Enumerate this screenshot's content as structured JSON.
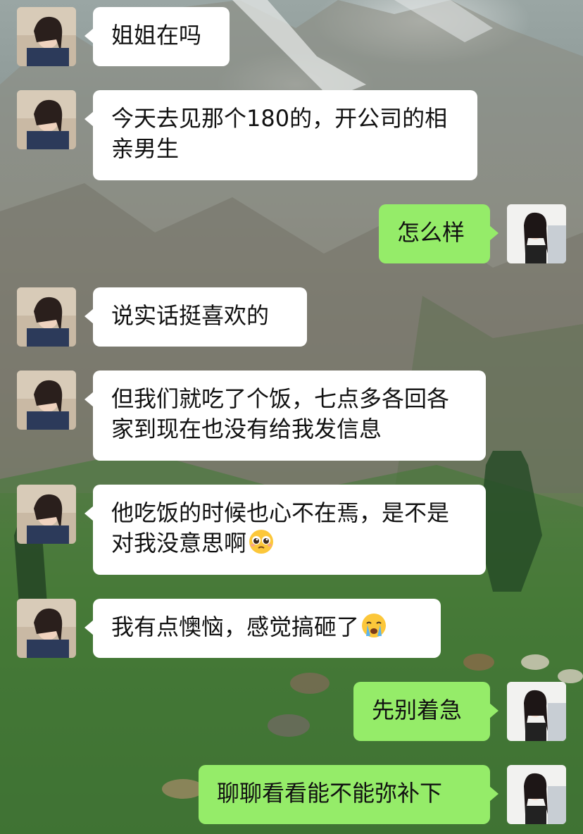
{
  "chat": {
    "messages": [
      {
        "side": "left",
        "text": "姐姐在吗"
      },
      {
        "side": "left",
        "text": "今天去见那个180的，开公司的相亲男生"
      },
      {
        "side": "right",
        "text": "怎么样"
      },
      {
        "side": "left",
        "text": "说实话挺喜欢的"
      },
      {
        "side": "left",
        "text": "但我们就吃了个饭，七点多各回各家到现在也没有给我发信息"
      },
      {
        "side": "left",
        "text": "他吃饭的时候也心不在焉，是不是对我没意思啊",
        "emoji": "pleading-face-emoji"
      },
      {
        "side": "left",
        "text": "我有点懊恼，感觉搞砸了",
        "emoji": "crying-face-emoji"
      },
      {
        "side": "right",
        "text": "先别着急"
      },
      {
        "side": "right",
        "text": "聊聊看看能不能弥补下"
      }
    ]
  },
  "colors": {
    "bubble_self": "#95ec69",
    "bubble_other": "#ffffff"
  }
}
